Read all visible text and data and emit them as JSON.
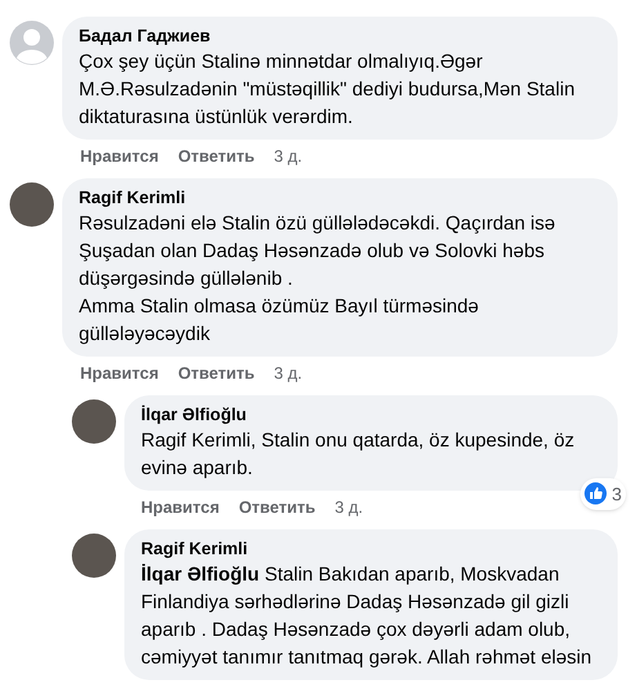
{
  "comments": [
    {
      "author": "Бадал Гаджиев",
      "kind": "default",
      "text": "Çox şey üçün Stalinə minnətdar olmalıyıq.Əgər M.Ə.Rəsulzadənin \"müstəqillik\" dediyi budursa,Mən Stalin diktaturasına üstünlük verərdim.",
      "actions": {
        "like": "Нравится",
        "reply": "Ответить",
        "time": "3 д."
      }
    },
    {
      "author": "Ragif Kerimli",
      "kind": "photo",
      "text": "Rəsulzadəni elə Stalin özü güllələdəcəkdi. Qaçırdan isə Şuşadan olan Dadaş Həsənzadə olub və Solovki həbs düşərgəsində güllələnib .\nAmma Stalin olmasa özümüz Bayıl türməsində güllələyəcəydik",
      "actions": {
        "like": "Нравится",
        "reply": "Ответить",
        "time": "3 д."
      },
      "children": [
        {
          "author": "İlqar Əlfioğlu",
          "kind": "photo",
          "text": "Ragif Kerimli, Stalin onu qatarda, öz kupesinde, öz evinə aparıb.",
          "reactions": "3",
          "actions": {
            "like": "Нравится",
            "reply": "Ответить",
            "time": "3 д."
          }
        },
        {
          "author": "Ragif Kerimli",
          "kind": "photo",
          "text": "**İlqar Əlfioğlu** Stalin Bakıdan aparıb, Moskvadan Finlandiya sərhədlərinə Dadaş Həsənzadə gil gizli aparıb . Dadaş Həsənzadə çox dəyərli adam olub, cəmiyyət tanımır tanıtmaq gərək. Allah rəhmət eləsin"
        }
      ]
    }
  ]
}
